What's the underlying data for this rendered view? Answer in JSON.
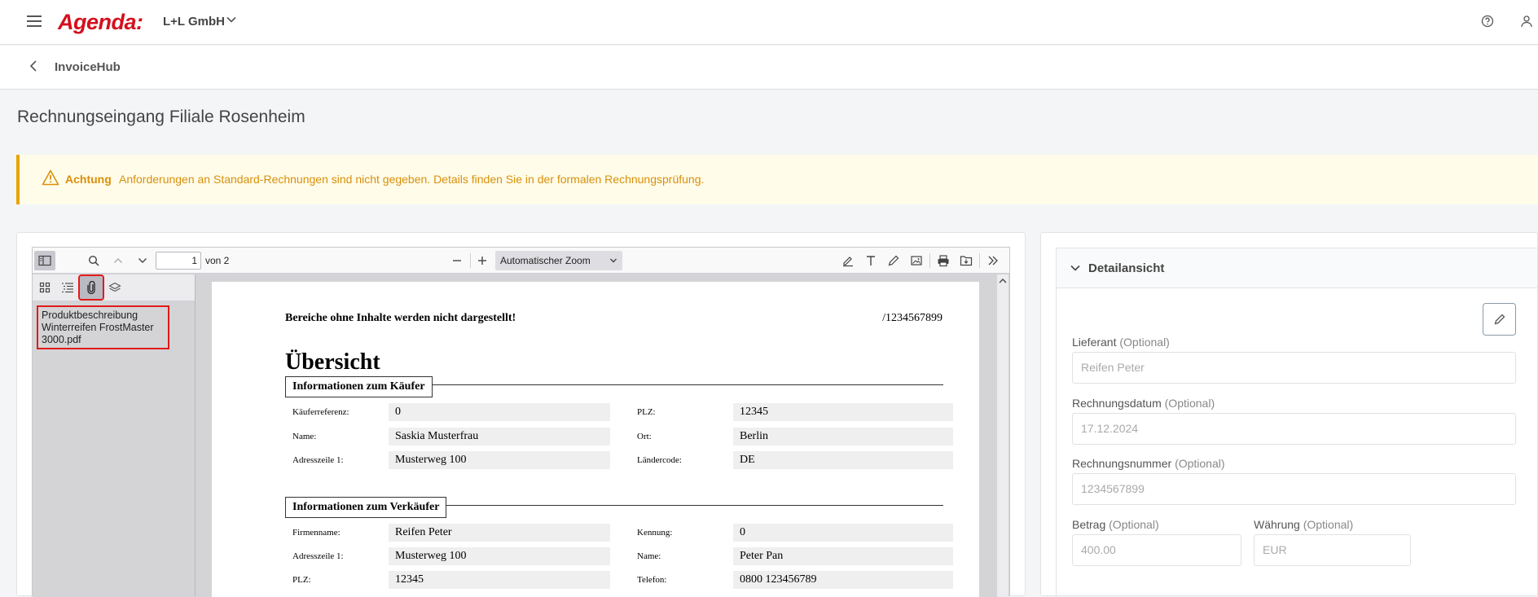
{
  "header": {
    "logo": "Agenda:",
    "company": "L+L GmbH"
  },
  "subheader": {
    "title": "InvoiceHub"
  },
  "page": {
    "title": "Rechnungseingang Filiale Rosenheim"
  },
  "alert": {
    "heading": "Achtung",
    "text": "Anforderungen an Standard-Rechnungen sind nicht gegeben. Details finden Sie in der formalen Rechnungsprüfung."
  },
  "pdf_viewer": {
    "current_page": "1",
    "page_count_label": "von 2",
    "zoom": "Automatischer Zoom",
    "attachment_name": "Produktbeschreibung Winterreifen FrostMaster 3000.pdf"
  },
  "document": {
    "note": "Bereiche ohne Inhalte werden nicht dargestellt!",
    "reference": "/1234567899",
    "heading": "Übersicht",
    "buyer_section": "Informationen zum Käufer",
    "buyer_rows": [
      {
        "label": "Käuferreferenz:",
        "value": "0",
        "label2": "PLZ:",
        "value2": "12345"
      },
      {
        "label": "Name:",
        "value": "Saskia Musterfrau",
        "label2": "Ort:",
        "value2": "Berlin"
      },
      {
        "label": "Adresszeile 1:",
        "value": "Musterweg 100",
        "label2": "Ländercode:",
        "value2": "DE"
      }
    ],
    "seller_section": "Informationen zum Verkäufer",
    "seller_rows": [
      {
        "label": "Firmenname:",
        "value": "Reifen Peter",
        "label2": "Kennung:",
        "value2": "0"
      },
      {
        "label": "Adresszeile 1:",
        "value": "Musterweg 100",
        "label2": "Name:",
        "value2": "Peter Pan"
      },
      {
        "label": "PLZ:",
        "value": "12345",
        "label2": "Telefon:",
        "value2": "0800 123456789"
      }
    ]
  },
  "details": {
    "title": "Detailansicht",
    "optional_suffix": "(Optional)",
    "fields": {
      "supplier": {
        "label": "Lieferant",
        "value": "Reifen Peter"
      },
      "invoice_date": {
        "label": "Rechnungsdatum",
        "value": "17.12.2024"
      },
      "invoice_number": {
        "label": "Rechnungsnummer",
        "value": "1234567899"
      },
      "amount": {
        "label": "Betrag",
        "value": "400.00"
      },
      "currency": {
        "label": "Währung",
        "value": "EUR"
      }
    }
  },
  "colors": {
    "brand_red": "#d4101d",
    "alert_text": "#d9900a",
    "alert_bg": "#fffcea",
    "highlight_red": "#e21a1a"
  }
}
